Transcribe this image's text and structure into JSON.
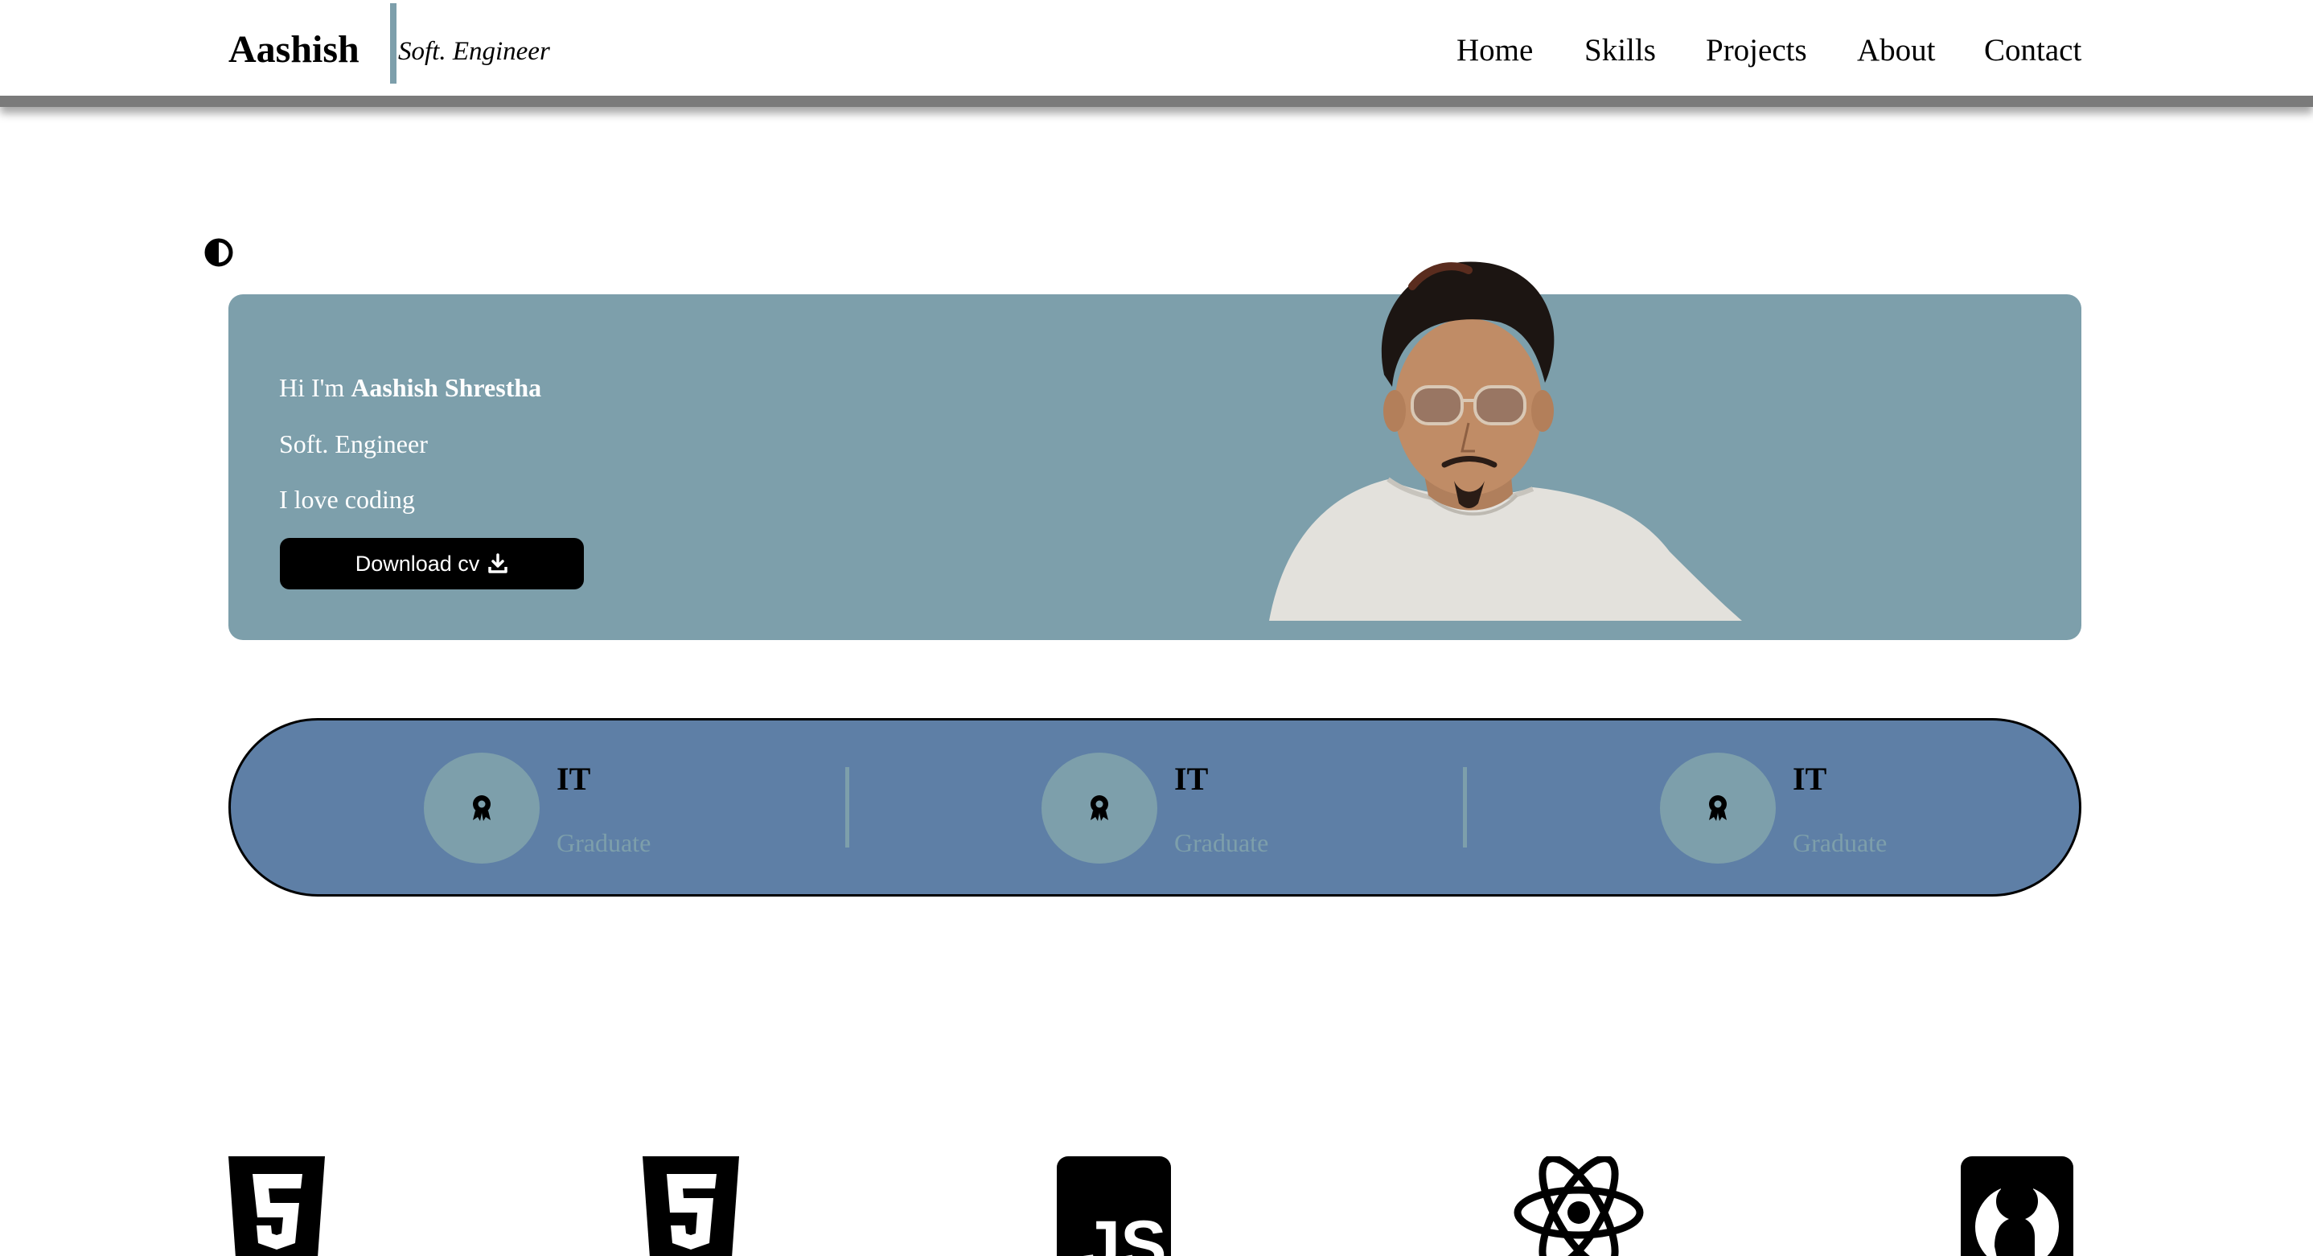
{
  "header": {
    "brand": "Aashish",
    "tagline": "Soft. Engineer",
    "nav": [
      {
        "label": "Home"
      },
      {
        "label": "Skills"
      },
      {
        "label": "Projects"
      },
      {
        "label": "About"
      },
      {
        "label": "Contact"
      }
    ]
  },
  "theme_toggle": {
    "icon": "half-circle-contrast-icon"
  },
  "hero": {
    "greeting_prefix": "Hi I'm ",
    "name": "Aashish Shrestha",
    "role": "Soft. Engineer",
    "motto": "I love coding",
    "download_label": "Download cv",
    "download_icon": "download-icon",
    "background": "#7d9fab"
  },
  "stats": {
    "background": "#5e7fa6",
    "items": [
      {
        "title": "IT",
        "subtitle": "Graduate",
        "icon": "award-icon"
      },
      {
        "title": "IT",
        "subtitle": "Graduate",
        "icon": "award-icon"
      },
      {
        "title": "IT",
        "subtitle": "Graduate",
        "icon": "award-icon"
      }
    ]
  },
  "skills": [
    {
      "icon": "html5-icon"
    },
    {
      "icon": "css3-icon"
    },
    {
      "icon": "javascript-icon",
      "label": "JS"
    },
    {
      "icon": "react-icon"
    },
    {
      "icon": "github-icon"
    }
  ]
}
